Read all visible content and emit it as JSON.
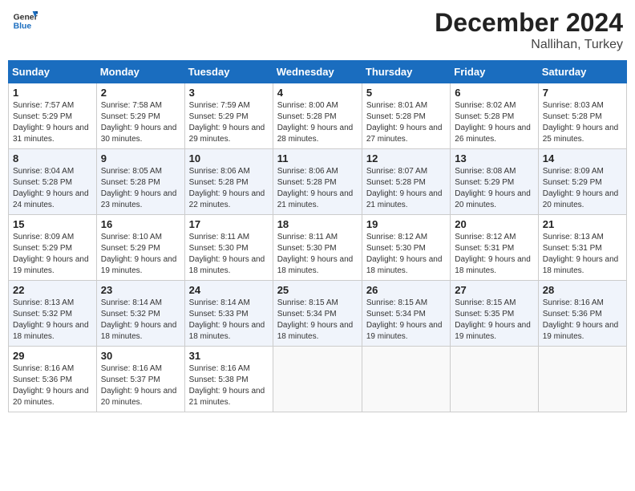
{
  "header": {
    "logo_line1": "General",
    "logo_line2": "Blue",
    "month_year": "December 2024",
    "location": "Nallihan, Turkey"
  },
  "weekdays": [
    "Sunday",
    "Monday",
    "Tuesday",
    "Wednesday",
    "Thursday",
    "Friday",
    "Saturday"
  ],
  "weeks": [
    [
      {
        "day": "1",
        "sunrise": "Sunrise: 7:57 AM",
        "sunset": "Sunset: 5:29 PM",
        "daylight": "Daylight: 9 hours and 31 minutes."
      },
      {
        "day": "2",
        "sunrise": "Sunrise: 7:58 AM",
        "sunset": "Sunset: 5:29 PM",
        "daylight": "Daylight: 9 hours and 30 minutes."
      },
      {
        "day": "3",
        "sunrise": "Sunrise: 7:59 AM",
        "sunset": "Sunset: 5:29 PM",
        "daylight": "Daylight: 9 hours and 29 minutes."
      },
      {
        "day": "4",
        "sunrise": "Sunrise: 8:00 AM",
        "sunset": "Sunset: 5:28 PM",
        "daylight": "Daylight: 9 hours and 28 minutes."
      },
      {
        "day": "5",
        "sunrise": "Sunrise: 8:01 AM",
        "sunset": "Sunset: 5:28 PM",
        "daylight": "Daylight: 9 hours and 27 minutes."
      },
      {
        "day": "6",
        "sunrise": "Sunrise: 8:02 AM",
        "sunset": "Sunset: 5:28 PM",
        "daylight": "Daylight: 9 hours and 26 minutes."
      },
      {
        "day": "7",
        "sunrise": "Sunrise: 8:03 AM",
        "sunset": "Sunset: 5:28 PM",
        "daylight": "Daylight: 9 hours and 25 minutes."
      }
    ],
    [
      {
        "day": "8",
        "sunrise": "Sunrise: 8:04 AM",
        "sunset": "Sunset: 5:28 PM",
        "daylight": "Daylight: 9 hours and 24 minutes."
      },
      {
        "day": "9",
        "sunrise": "Sunrise: 8:05 AM",
        "sunset": "Sunset: 5:28 PM",
        "daylight": "Daylight: 9 hours and 23 minutes."
      },
      {
        "day": "10",
        "sunrise": "Sunrise: 8:06 AM",
        "sunset": "Sunset: 5:28 PM",
        "daylight": "Daylight: 9 hours and 22 minutes."
      },
      {
        "day": "11",
        "sunrise": "Sunrise: 8:06 AM",
        "sunset": "Sunset: 5:28 PM",
        "daylight": "Daylight: 9 hours and 21 minutes."
      },
      {
        "day": "12",
        "sunrise": "Sunrise: 8:07 AM",
        "sunset": "Sunset: 5:28 PM",
        "daylight": "Daylight: 9 hours and 21 minutes."
      },
      {
        "day": "13",
        "sunrise": "Sunrise: 8:08 AM",
        "sunset": "Sunset: 5:29 PM",
        "daylight": "Daylight: 9 hours and 20 minutes."
      },
      {
        "day": "14",
        "sunrise": "Sunrise: 8:09 AM",
        "sunset": "Sunset: 5:29 PM",
        "daylight": "Daylight: 9 hours and 20 minutes."
      }
    ],
    [
      {
        "day": "15",
        "sunrise": "Sunrise: 8:09 AM",
        "sunset": "Sunset: 5:29 PM",
        "daylight": "Daylight: 9 hours and 19 minutes."
      },
      {
        "day": "16",
        "sunrise": "Sunrise: 8:10 AM",
        "sunset": "Sunset: 5:29 PM",
        "daylight": "Daylight: 9 hours and 19 minutes."
      },
      {
        "day": "17",
        "sunrise": "Sunrise: 8:11 AM",
        "sunset": "Sunset: 5:30 PM",
        "daylight": "Daylight: 9 hours and 18 minutes."
      },
      {
        "day": "18",
        "sunrise": "Sunrise: 8:11 AM",
        "sunset": "Sunset: 5:30 PM",
        "daylight": "Daylight: 9 hours and 18 minutes."
      },
      {
        "day": "19",
        "sunrise": "Sunrise: 8:12 AM",
        "sunset": "Sunset: 5:30 PM",
        "daylight": "Daylight: 9 hours and 18 minutes."
      },
      {
        "day": "20",
        "sunrise": "Sunrise: 8:12 AM",
        "sunset": "Sunset: 5:31 PM",
        "daylight": "Daylight: 9 hours and 18 minutes."
      },
      {
        "day": "21",
        "sunrise": "Sunrise: 8:13 AM",
        "sunset": "Sunset: 5:31 PM",
        "daylight": "Daylight: 9 hours and 18 minutes."
      }
    ],
    [
      {
        "day": "22",
        "sunrise": "Sunrise: 8:13 AM",
        "sunset": "Sunset: 5:32 PM",
        "daylight": "Daylight: 9 hours and 18 minutes."
      },
      {
        "day": "23",
        "sunrise": "Sunrise: 8:14 AM",
        "sunset": "Sunset: 5:32 PM",
        "daylight": "Daylight: 9 hours and 18 minutes."
      },
      {
        "day": "24",
        "sunrise": "Sunrise: 8:14 AM",
        "sunset": "Sunset: 5:33 PM",
        "daylight": "Daylight: 9 hours and 18 minutes."
      },
      {
        "day": "25",
        "sunrise": "Sunrise: 8:15 AM",
        "sunset": "Sunset: 5:34 PM",
        "daylight": "Daylight: 9 hours and 18 minutes."
      },
      {
        "day": "26",
        "sunrise": "Sunrise: 8:15 AM",
        "sunset": "Sunset: 5:34 PM",
        "daylight": "Daylight: 9 hours and 19 minutes."
      },
      {
        "day": "27",
        "sunrise": "Sunrise: 8:15 AM",
        "sunset": "Sunset: 5:35 PM",
        "daylight": "Daylight: 9 hours and 19 minutes."
      },
      {
        "day": "28",
        "sunrise": "Sunrise: 8:16 AM",
        "sunset": "Sunset: 5:36 PM",
        "daylight": "Daylight: 9 hours and 19 minutes."
      }
    ],
    [
      {
        "day": "29",
        "sunrise": "Sunrise: 8:16 AM",
        "sunset": "Sunset: 5:36 PM",
        "daylight": "Daylight: 9 hours and 20 minutes."
      },
      {
        "day": "30",
        "sunrise": "Sunrise: 8:16 AM",
        "sunset": "Sunset: 5:37 PM",
        "daylight": "Daylight: 9 hours and 20 minutes."
      },
      {
        "day": "31",
        "sunrise": "Sunrise: 8:16 AM",
        "sunset": "Sunset: 5:38 PM",
        "daylight": "Daylight: 9 hours and 21 minutes."
      },
      null,
      null,
      null,
      null
    ]
  ]
}
